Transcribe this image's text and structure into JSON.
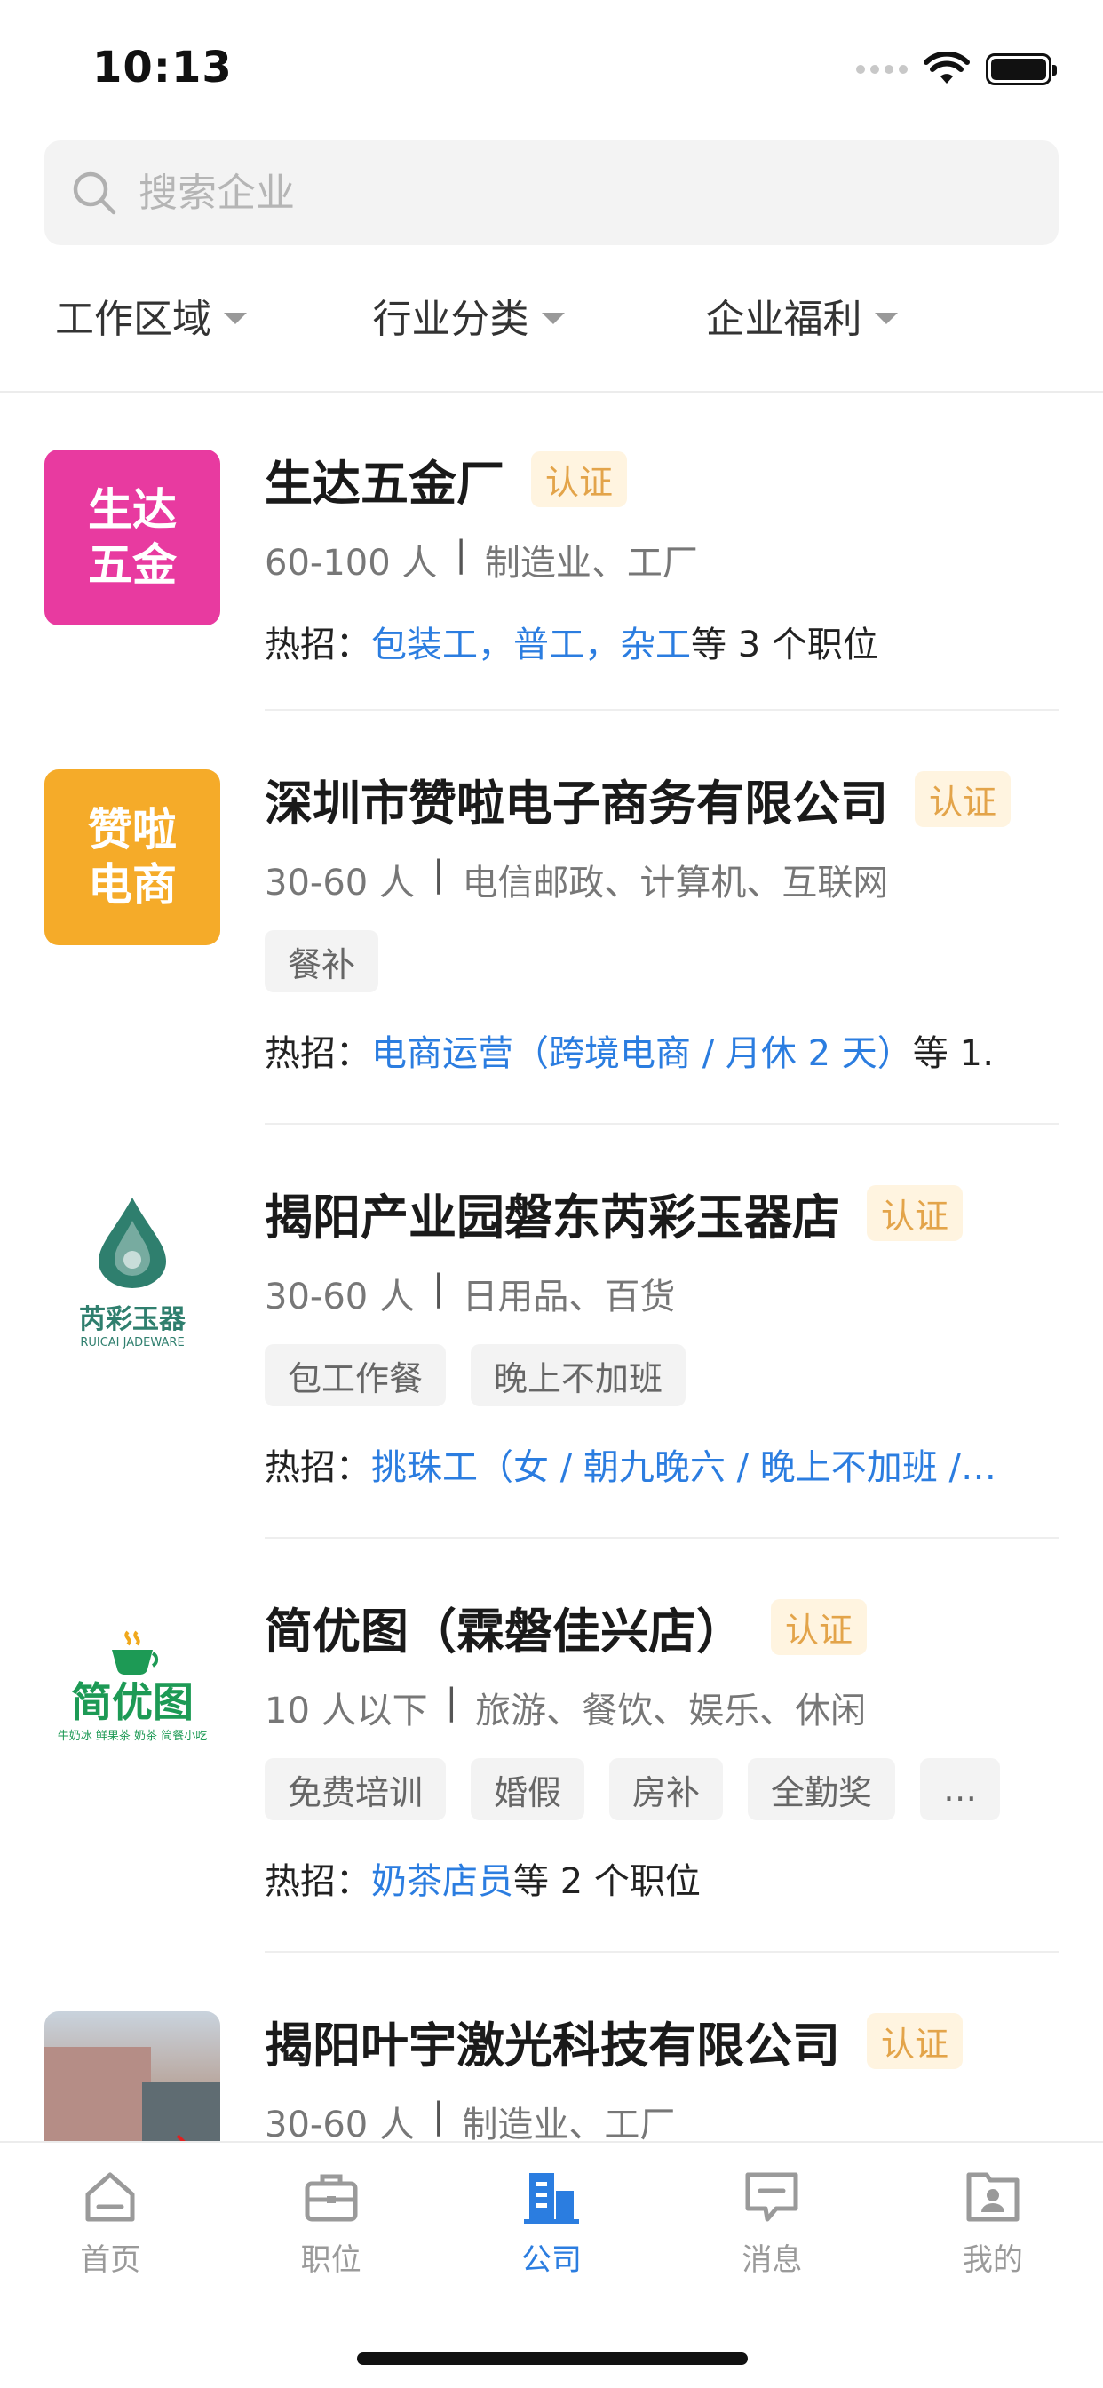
{
  "status_bar": {
    "time": "10:13"
  },
  "search": {
    "placeholder": "搜索企业"
  },
  "filters": [
    {
      "label": "工作区域"
    },
    {
      "label": "行业分类"
    },
    {
      "label": "企业福利"
    }
  ],
  "companies": [
    {
      "logo_text": [
        "生达",
        "五金"
      ],
      "logo_color": "#e83aa0",
      "name": "生达五金厂",
      "badge": "认证",
      "size": "60-100 人",
      "industry": "制造业、工厂",
      "tags": [],
      "hot_prefix": "热招：",
      "hot_jobs": "包装工，普工，杂工",
      "hot_suffix": "等 3 个职位"
    },
    {
      "logo_text": [
        "赞啦",
        "电商"
      ],
      "logo_color": "#f5ab29",
      "name": "深圳市赞啦电子商务有限公司",
      "badge": "认证",
      "size": "30-60 人",
      "industry": "电信邮政、计算机、互联网",
      "tags": [
        "餐补"
      ],
      "hot_prefix": "热招：",
      "hot_jobs": "电商运营（跨境电商 / 月休 2 天）",
      "hot_suffix": "等 1…"
    },
    {
      "logo_text": [
        "芮彩玉器",
        "RUICAI JADEWARE"
      ],
      "logo_color": "#2f7f6e",
      "name": "揭阳产业园磐东芮彩玉器店",
      "badge": "认证",
      "size": "30-60 人",
      "industry": "日用品、百货",
      "tags": [
        "包工作餐",
        "晚上不加班"
      ],
      "hot_prefix": "热招：",
      "hot_jobs": "挑珠工（女 / 朝九晚六 / 晚上不加班 /…",
      "hot_suffix": ""
    },
    {
      "logo_text": [
        "简优图",
        "牛奶冰 鲜果茶 奶茶 简餐小吃"
      ],
      "logo_color": "#1d9a55",
      "name": "简优图（霖磐佳兴店）",
      "badge": "认证",
      "size": "10 人以下",
      "industry": "旅游、餐饮、娱乐、休闲",
      "tags": [
        "免费培训",
        "婚假",
        "房补",
        "全勤奖",
        "…"
      ],
      "hot_prefix": "热招：",
      "hot_jobs": "奶茶店员",
      "hot_suffix": "等 2 个职位"
    },
    {
      "logo_text": [],
      "logo_color": "#8a7f7a",
      "name": "揭阳叶宇激光科技有限公司",
      "badge": "认证",
      "size": "30-60 人",
      "industry": "制造业、工厂",
      "tags": [],
      "hot_prefix": "",
      "hot_jobs": "",
      "hot_suffix": ""
    }
  ],
  "tab_bar": {
    "tabs": [
      {
        "label": "首页",
        "icon": "home-icon"
      },
      {
        "label": "职位",
        "icon": "briefcase-icon"
      },
      {
        "label": "公司",
        "icon": "building-icon",
        "active": true
      },
      {
        "label": "消息",
        "icon": "message-icon"
      },
      {
        "label": "我的",
        "icon": "profile-icon"
      }
    ]
  },
  "colors": {
    "accent": "#2b7de0",
    "badge_bg": "#fff4e0",
    "badge_text": "#e3a44a"
  }
}
